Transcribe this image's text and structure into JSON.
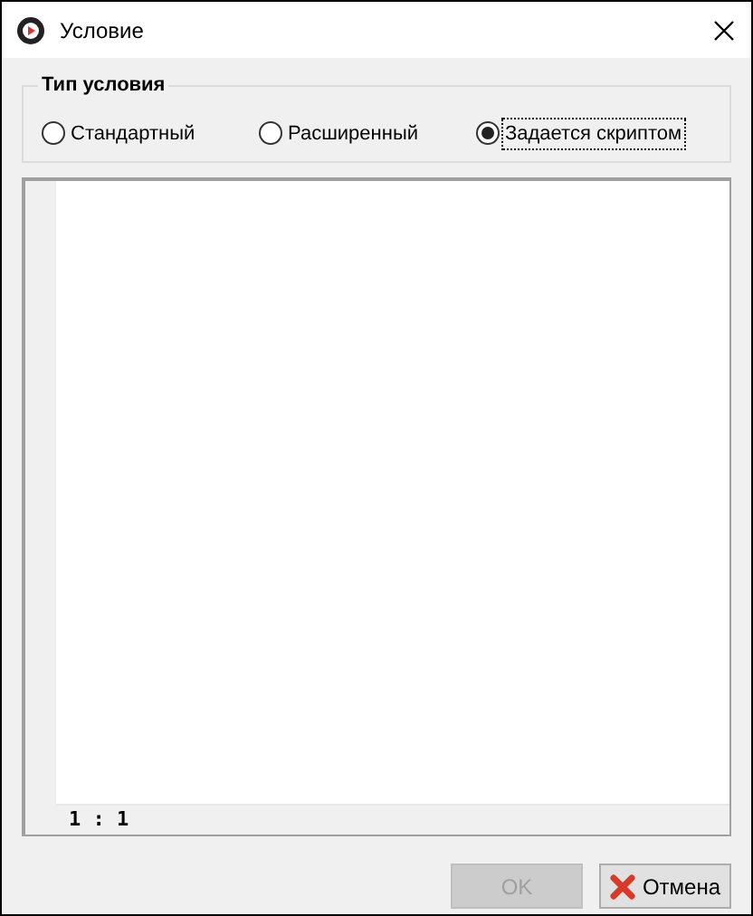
{
  "window": {
    "title": "Условие"
  },
  "condition_type": {
    "title": "Тип условия",
    "options": [
      {
        "label": "Стандартный",
        "selected": false
      },
      {
        "label": "Расширенный",
        "selected": false
      },
      {
        "label": "Задается скриптом",
        "selected": true
      }
    ]
  },
  "editor": {
    "cursor_position": "1 : 1"
  },
  "buttons": [
    {
      "label": "OK",
      "disabled": true,
      "kind": "ok"
    },
    {
      "label": "Отмена",
      "disabled": false,
      "kind": "cancel"
    }
  ]
}
